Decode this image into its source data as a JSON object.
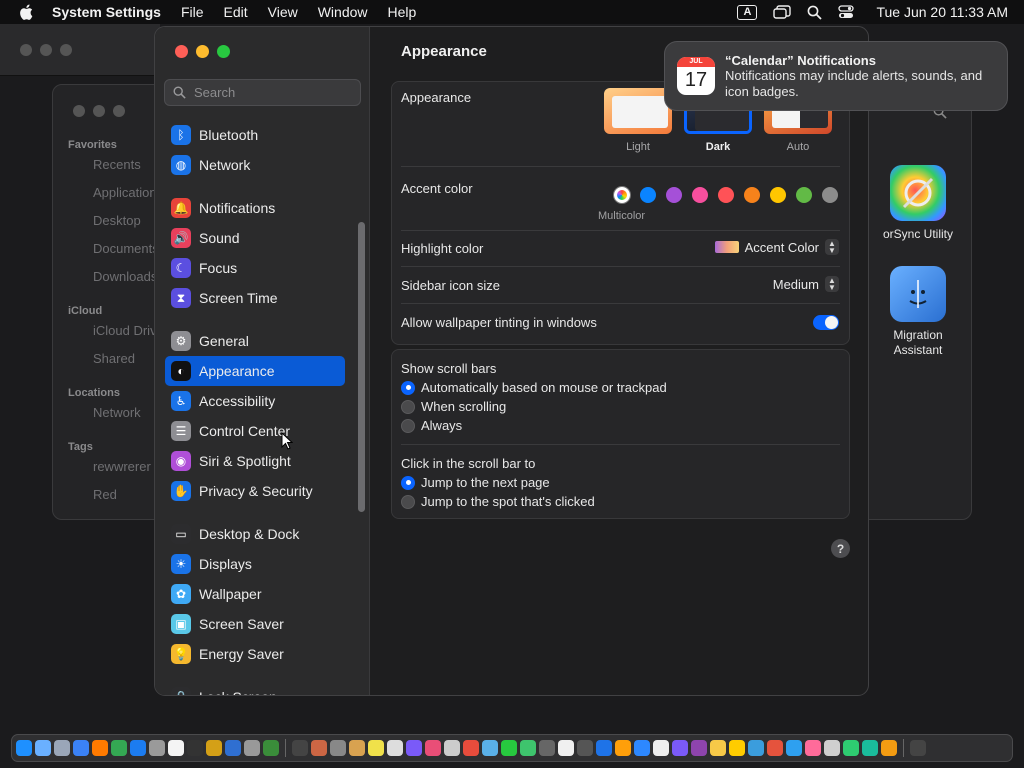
{
  "menubar": {
    "app_name": "System Settings",
    "menus": [
      "File",
      "Edit",
      "View",
      "Window",
      "Help"
    ],
    "input_source": "A",
    "clock": "Tue Jun 20  11:33 AM"
  },
  "finder": {
    "sidebar": [
      {
        "section": "Favorites",
        "items": [
          "Recents",
          "Applications",
          "Desktop",
          "Documents",
          "Downloads"
        ]
      },
      {
        "section": "iCloud",
        "items": [
          "iCloud Drive",
          "Shared"
        ]
      },
      {
        "section": "Locations",
        "items": [
          "Network"
        ]
      },
      {
        "section": "Tags",
        "items": [
          "rewwrerer",
          "Red"
        ]
      }
    ],
    "apps": [
      {
        "label": "orSync Utility",
        "icon": "colorsync-icon"
      },
      {
        "label": "Migration\nAssistant",
        "icon": "migration-icon"
      }
    ]
  },
  "settings": {
    "search_placeholder": "Search",
    "sidebar": [
      {
        "label": "Bluetooth",
        "icon": "bluetooth-icon",
        "color": "#1a73e8",
        "glyph": "ᛒ"
      },
      {
        "label": "Network",
        "icon": "globe-icon",
        "color": "#1a73e8",
        "glyph": "◍"
      },
      {
        "label": "Notifications",
        "icon": "bell-icon",
        "color": "#e8443a",
        "glyph": "🔔"
      },
      {
        "label": "Sound",
        "icon": "speaker-icon",
        "color": "#e8405c",
        "glyph": "🔊"
      },
      {
        "label": "Focus",
        "icon": "moon-icon",
        "color": "#5b4fe0",
        "glyph": "☾"
      },
      {
        "label": "Screen Time",
        "icon": "hourglass-icon",
        "color": "#5b4fe0",
        "glyph": "⧗"
      },
      {
        "label": "General",
        "icon": "gear-icon",
        "color": "#8e8e93",
        "glyph": "⚙"
      },
      {
        "label": "Appearance",
        "icon": "appearance-icon",
        "color": "#111111",
        "glyph": "◐"
      },
      {
        "label": "Accessibility",
        "icon": "accessibility-icon",
        "color": "#1a73e8",
        "glyph": "♿"
      },
      {
        "label": "Control Center",
        "icon": "control-center-icon",
        "color": "#8e8e93",
        "glyph": "☰"
      },
      {
        "label": "Siri & Spotlight",
        "icon": "siri-icon",
        "color": "#b04fd8",
        "glyph": "◉"
      },
      {
        "label": "Privacy & Security",
        "icon": "hand-icon",
        "color": "#1a73e8",
        "glyph": "✋"
      },
      {
        "label": "Desktop & Dock",
        "icon": "dock-icon",
        "color": "#2c2c2e",
        "glyph": "▭"
      },
      {
        "label": "Displays",
        "icon": "sun-icon",
        "color": "#1a73e8",
        "glyph": "☀"
      },
      {
        "label": "Wallpaper",
        "icon": "flower-icon",
        "color": "#3fa9f5",
        "glyph": "✿"
      },
      {
        "label": "Screen Saver",
        "icon": "screen-saver-icon",
        "color": "#5ac8e8",
        "glyph": "▣"
      },
      {
        "label": "Energy Saver",
        "icon": "bulb-icon",
        "color": "#f5b82e",
        "glyph": "💡"
      },
      {
        "label": "Lock Screen",
        "icon": "lock-icon",
        "color": "#2c2c2e",
        "glyph": "🔒"
      }
    ],
    "selected": "Appearance",
    "pane": {
      "title": "Appearance",
      "appearance_label": "Appearance",
      "themes": [
        "Light",
        "Dark",
        "Auto"
      ],
      "selected_theme": "Dark",
      "accent_label": "Accent color",
      "accent_colors": [
        "#0a84ff",
        "#a550d8",
        "#f74f9e",
        "#ff5257",
        "#f7821b",
        "#ffc600",
        "#62ba46",
        "#8c8c8c"
      ],
      "multicolor_label": "Multicolor",
      "highlight_label": "Highlight color",
      "highlight_value": "Accent Color",
      "icon_size_label": "Sidebar icon size",
      "icon_size_value": "Medium",
      "tinting_label": "Allow wallpaper tinting in windows",
      "tinting_on": true,
      "scroll_label": "Show scroll bars",
      "scroll_options": [
        "Automatically based on mouse or trackpad",
        "When scrolling",
        "Always"
      ],
      "click_label": "Click in the scroll bar to",
      "click_options": [
        "Jump to the next page",
        "Jump to the spot that's clicked"
      ],
      "help": "?"
    }
  },
  "notification": {
    "title": "“Calendar” Notifications",
    "body": "Notifications may include alerts, sounds, and icon badges.",
    "cal_month": "JUL",
    "cal_day": "17"
  },
  "dock_colors": [
    "#1e90ff",
    "#6ab0ff",
    "#9aa6b8",
    "#3b82f6",
    "#ff7a00",
    "#34a853",
    "#1c7cf0",
    "#9a9a9a",
    "#f4f4f4",
    "#333333",
    "#d4a017",
    "#2f6fd1",
    "#999999",
    "#3a8d3a",
    "#444444",
    "#c64",
    "#888888",
    "#d8a250",
    "#f0e14a",
    "#ddd",
    "#7a5af8",
    "#e94e77",
    "#cccccc",
    "#e74c3c",
    "#5ab0e8",
    "#27c93f",
    "#3ec46d",
    "#666",
    "#f0f0f0",
    "#555",
    "#1e73e8",
    "#ff9f0a",
    "#2d88ff",
    "#eeeeee",
    "#7a5af8",
    "#8e44ad",
    "#f7c948",
    "#ffcc00",
    "#3b9ddd",
    "#e5533d",
    "#2ea0f0",
    "#ff6b9a",
    "#cfcfcf",
    "#2ecc71",
    "#1abc9c",
    "#f39c12",
    "#444"
  ]
}
